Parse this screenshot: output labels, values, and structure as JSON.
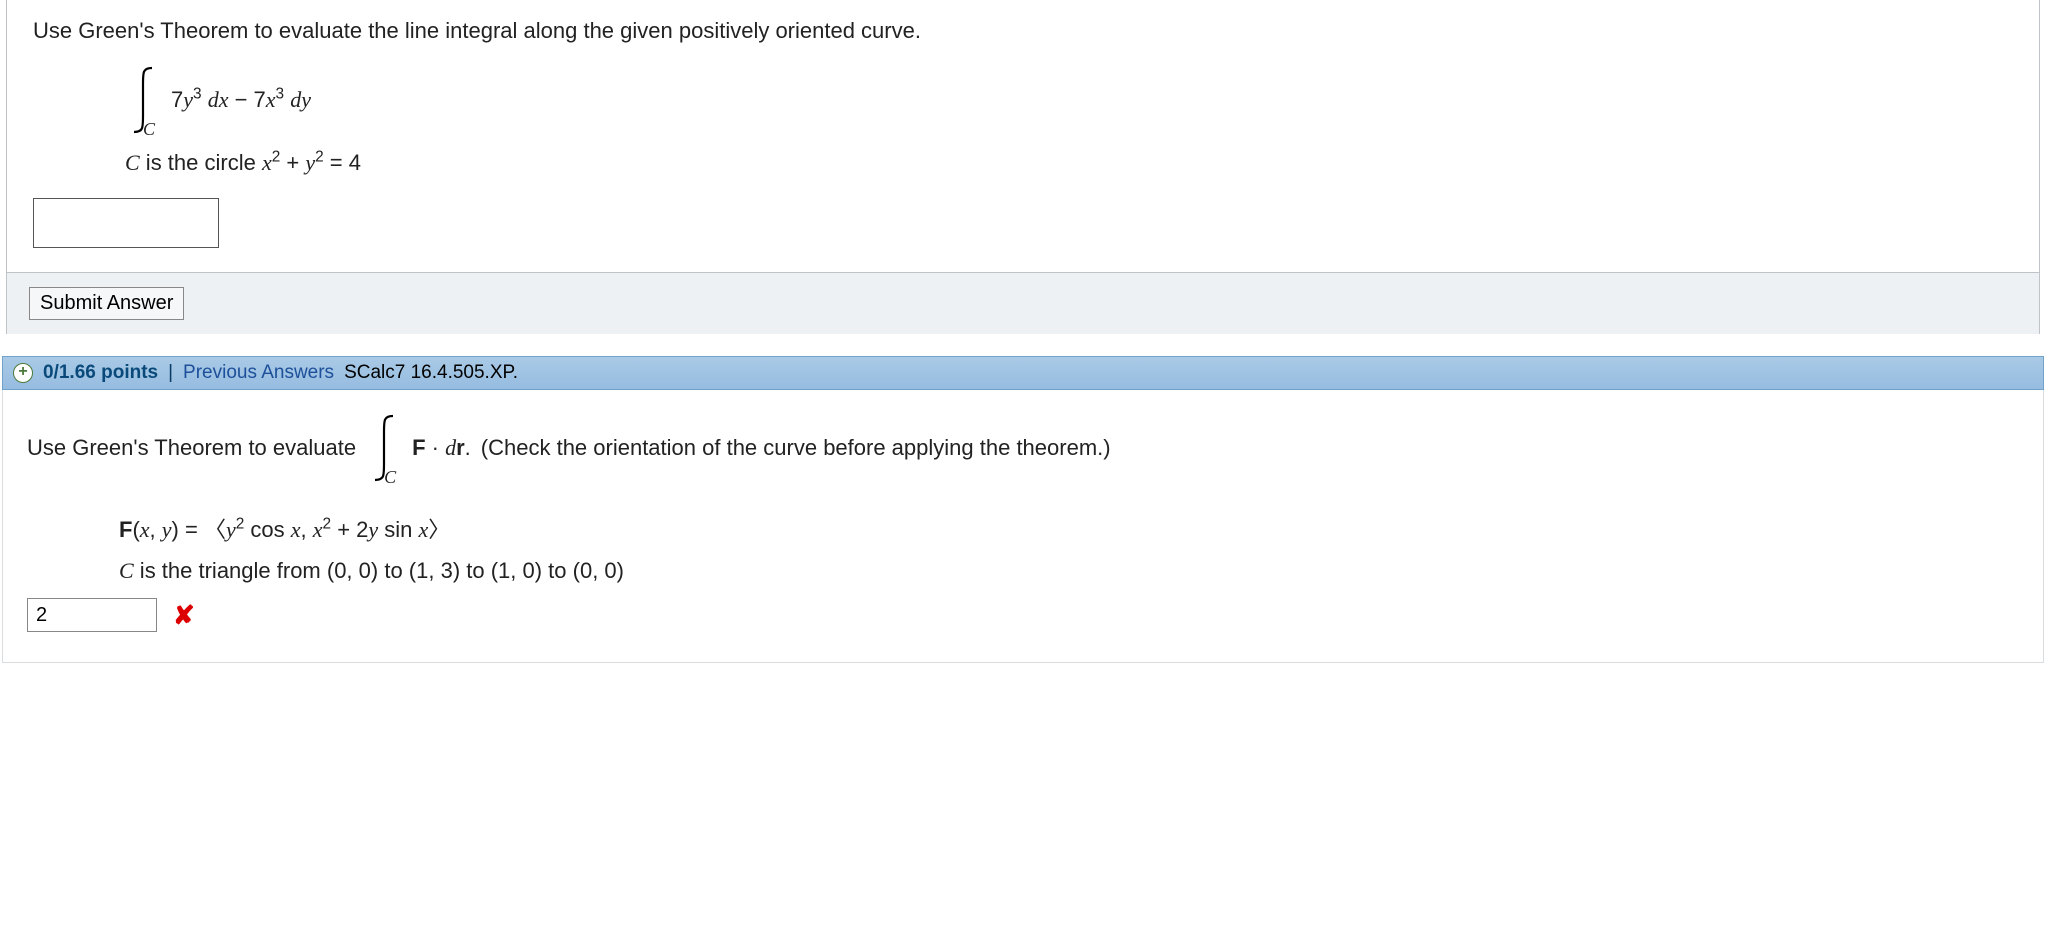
{
  "q1": {
    "prompt": "Use Green's Theorem to evaluate the line integral along the given positively oriented curve.",
    "integral_sub": "C",
    "integrand_html": "7<span class='math'>y</span><sup>3</sup> <span class='math'>dx</span> − 7<span class='math'>x</span><sup>3</sup> <span class='math'>dy</span>",
    "curve_html": "<span class='math'>C</span> is the circle <span class='math'>x</span><sup>2</sup> + <span class='math'>y</span><sup>2</sup> = 4",
    "answer_value": "",
    "submit_label": "Submit Answer"
  },
  "score": {
    "points": "0/1.66 points",
    "divider": "|",
    "prev": "Previous Answers",
    "ref": "SCalc7 16.4.505.XP."
  },
  "q2": {
    "prompt_before": "Use Green's Theorem to evaluate ",
    "integral_sub": "C",
    "integrand_html": "<b>F</b> · <span class='math'>d</span><b>r</b>.",
    "prompt_after": "  (Check the orientation of the curve before applying the theorem.)",
    "F_html": "<b>F</b>(<span class='math'>x</span>, <span class='math'>y</span>) = <span class='angle'>〈</span><span class='math'>y</span><sup>2</sup> cos <span class='math'>x</span>, <span class='math'>x</span><sup>2</sup> + 2<span class='math'>y</span> sin <span class='math'>x</span><span class='angle'>〉</span>",
    "curve_html": "<span class='math'>C</span> is the triangle from (0, 0) to (1, 3) to (1, 0) to (0, 0)",
    "answer_value": "2"
  }
}
